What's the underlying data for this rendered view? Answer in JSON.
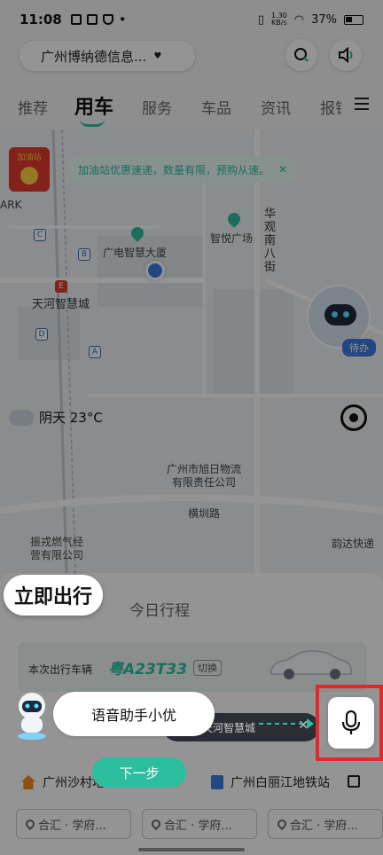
{
  "status_bar": {
    "time": "11:08",
    "speed_top": "1.30",
    "speed_bottom": "KB/s",
    "battery": "37%"
  },
  "header": {
    "location": "广州博纳德信息...",
    "location_arrow": "♥"
  },
  "tabs": [
    "推荐",
    "用车",
    "服务",
    "车品",
    "资讯",
    "报销"
  ],
  "active_tab_index": 1,
  "map": {
    "promo_text": "加油站优惠速递，数量有限，预购从速。",
    "promo_close": "✕",
    "gas_station_label": "加油站",
    "labels": {
      "ark": "ARK",
      "guangdian": "广电智慧大厦",
      "zhiyue": "智悦广场",
      "huaguan": [
        "华",
        "观",
        "南",
        "八",
        "街"
      ],
      "tianhe": "天河智慧城",
      "xuri_line1": "广州市旭日物流",
      "xuri_line2": "有限责任公司",
      "hengzhen": "横圳路",
      "yunda": "韵达快递",
      "zhenyao_line1": "振戎燃气经",
      "zhenyao_line2": "营有限公司"
    },
    "metro_letters": [
      "C",
      "B",
      "E",
      "D",
      "A"
    ],
    "pending_badge": "待办",
    "weather": "阴天 23°C"
  },
  "card": {
    "go_now": "立即出行",
    "today_trip": "今日行程",
    "vehicle_label": "本次出行车辆",
    "plate": "粤A23T33",
    "switch": "切换"
  },
  "assistant": {
    "bubble": "语音助手小优",
    "destination": "天河智慧城",
    "destination_close": "✕",
    "next_step": "下一步"
  },
  "stations": {
    "home": "广州沙村地铁站",
    "work": "广州白丽江地铁站"
  },
  "chips": [
    "合汇 · 学府...",
    "合汇 · 学府...",
    "合汇 · 学府..."
  ],
  "colors": {
    "accent": "#2bbf9f",
    "highlight_frame": "#e02a2a",
    "metro": "#3b6bb5"
  }
}
